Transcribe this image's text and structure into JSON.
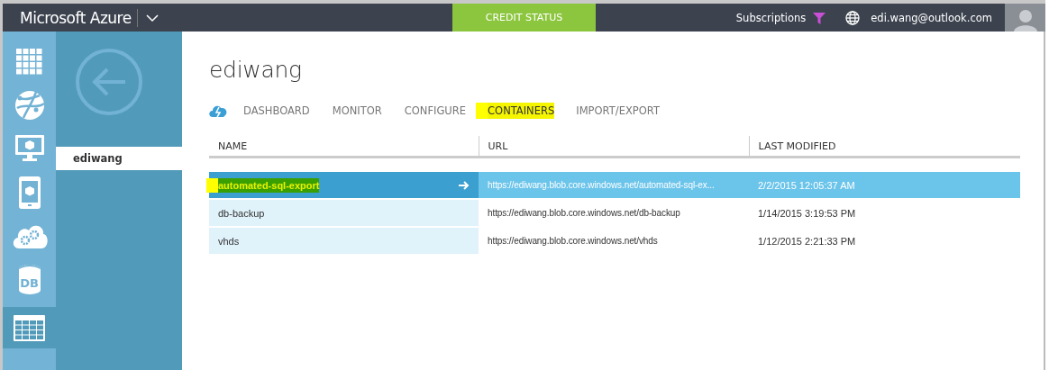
{
  "topbar": {
    "brand": "Microsoft Azure",
    "credit_button": "CREDIT STATUS",
    "subscriptions": "Subscriptions",
    "account": "edi.wang@outlook.com"
  },
  "rail": {
    "items": [
      {
        "kind": "grid",
        "selected": false
      },
      {
        "kind": "globe",
        "selected": false
      },
      {
        "kind": "monitor",
        "selected": false
      },
      {
        "kind": "phone",
        "selected": false
      },
      {
        "kind": "cloud",
        "selected": false
      },
      {
        "kind": "db",
        "label": "DB",
        "selected": false
      },
      {
        "kind": "table",
        "selected": true
      }
    ]
  },
  "nav": {
    "items": [
      {
        "label": "ediwang",
        "selected": true
      }
    ]
  },
  "main": {
    "title": "ediwang",
    "tabs": [
      {
        "label": "DASHBOARD",
        "selected": false,
        "highlighted": false
      },
      {
        "label": "MONITOR",
        "selected": false,
        "highlighted": false
      },
      {
        "label": "CONFIGURE",
        "selected": false,
        "highlighted": false
      },
      {
        "label": "CONTAINERS",
        "selected": true,
        "highlighted": true
      },
      {
        "label": "IMPORT/EXPORT",
        "selected": false,
        "highlighted": false
      }
    ],
    "table": {
      "columns": [
        "NAME",
        "URL",
        "LAST MODIFIED"
      ],
      "rows": [
        {
          "name": "automated-sql-export",
          "url": "https://ediwang.blob.core.windows.net/automated-sql-ex...",
          "last_modified": "2/2/2015 12:05:37 AM",
          "selected": true,
          "highlighted": true
        },
        {
          "name": "db-backup",
          "url": "https://ediwang.blob.core.windows.net/db-backup",
          "last_modified": "1/14/2015 3:19:53 PM",
          "selected": false,
          "highlighted": false
        },
        {
          "name": "vhds",
          "url": "https://ediwang.blob.core.windows.net/vhds",
          "last_modified": "1/12/2015 2:21:33 PM",
          "selected": false,
          "highlighted": false
        }
      ]
    }
  }
}
